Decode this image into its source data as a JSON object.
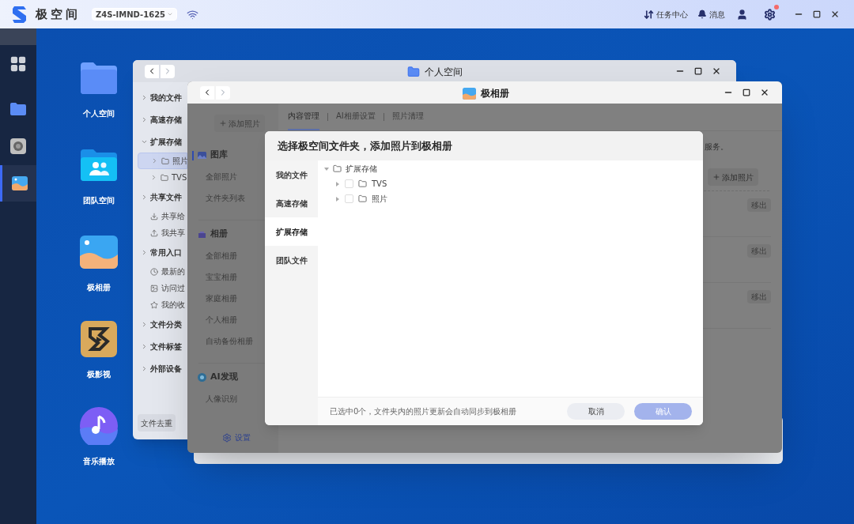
{
  "top_bar": {
    "brand": "极空间",
    "device": "Z4S-IMND-1625",
    "actions": [
      {
        "label": "任务中心",
        "kind": "tasks"
      },
      {
        "label": "消息",
        "kind": "messages"
      }
    ],
    "settings_notification": true
  },
  "dock": [
    {
      "kind": "apps",
      "selected": false
    },
    {
      "kind": "files",
      "selected": false
    },
    {
      "kind": "camera",
      "selected": false
    },
    {
      "kind": "photos",
      "selected": true
    }
  ],
  "desktop_icons": [
    {
      "kind": "folder",
      "label": "个人空间"
    },
    {
      "kind": "team",
      "label": "团队空间"
    },
    {
      "kind": "album",
      "label": "极相册"
    },
    {
      "kind": "video",
      "label": "极影视"
    },
    {
      "kind": "music",
      "label": "音乐播放"
    }
  ],
  "window_personal": {
    "title": "个人空间",
    "sidebar": [
      {
        "kind": "section",
        "label": "我的文件",
        "expanded": false
      },
      {
        "kind": "section",
        "label": "高速存储",
        "expanded": false
      },
      {
        "kind": "section",
        "label": "扩展存储",
        "expanded": true,
        "children": [
          {
            "kind": "folder",
            "label": "照片",
            "selected": true
          },
          {
            "kind": "folder",
            "label": "TVS",
            "selected": false
          }
        ]
      },
      {
        "kind": "section",
        "label": "共享文件",
        "expanded": false,
        "children": [
          {
            "kind": "received",
            "label": "共享给"
          },
          {
            "kind": "shared",
            "label": "我共享"
          }
        ]
      },
      {
        "kind": "section",
        "label": "常用入口",
        "expanded": false,
        "children": [
          {
            "kind": "recent",
            "label": "最新的"
          },
          {
            "kind": "visited",
            "label": "访问过"
          },
          {
            "kind": "favorite",
            "label": "我的收"
          }
        ]
      },
      {
        "kind": "section",
        "label": "文件分类",
        "expanded": false
      },
      {
        "kind": "section",
        "label": "文件标签",
        "expanded": false
      },
      {
        "kind": "section",
        "label": "外部设备",
        "expanded": false
      }
    ],
    "buttons": [
      "文件去重"
    ]
  },
  "window_album": {
    "title": "极相册",
    "add_button": "添加照片",
    "sections": [
      {
        "kind": "gallery",
        "title": "图库",
        "selected": true,
        "items": [
          "全部照片",
          "文件夹列表"
        ]
      },
      {
        "kind": "albums",
        "title": "相册",
        "selected": false,
        "items": [
          "全部相册",
          "宝宝相册",
          "家庭相册",
          "个人相册",
          "自动备份相册"
        ]
      },
      {
        "kind": "ai",
        "title": "AI发现",
        "selected": false,
        "items": [
          "人像识别"
        ]
      }
    ],
    "settings": "设置",
    "tabs": [
      {
        "label": "内容管理",
        "selected": true
      },
      {
        "label": "AI相册设置",
        "selected": false
      },
      {
        "label": "照片清理",
        "selected": false
      }
    ],
    "notice": "服务。",
    "add_photo_button": "添加照片",
    "rows": [
      {
        "action": "移出"
      },
      {
        "action": "移出"
      },
      {
        "action": "移出"
      }
    ]
  },
  "dialog": {
    "title": "选择极空间文件夹，添加照片到极相册",
    "nav": [
      {
        "label": "我的文件",
        "selected": false
      },
      {
        "label": "高速存储",
        "selected": false
      },
      {
        "label": "扩展存储",
        "selected": true
      },
      {
        "label": "团队文件",
        "selected": false
      }
    ],
    "tree": {
      "label": "扩展存储",
      "expanded": true,
      "children": [
        {
          "label": "TVS",
          "checked": false,
          "expanded": false
        },
        {
          "label": "照片",
          "checked": false,
          "expanded": false
        }
      ]
    },
    "footer_note": "已选中0个，文件夹内的照片更新会自动同步到极相册",
    "buttons": [
      {
        "kind": "cancel",
        "label": "取消",
        "disabled": false
      },
      {
        "kind": "confirm",
        "label": "确认",
        "disabled": true
      }
    ]
  }
}
